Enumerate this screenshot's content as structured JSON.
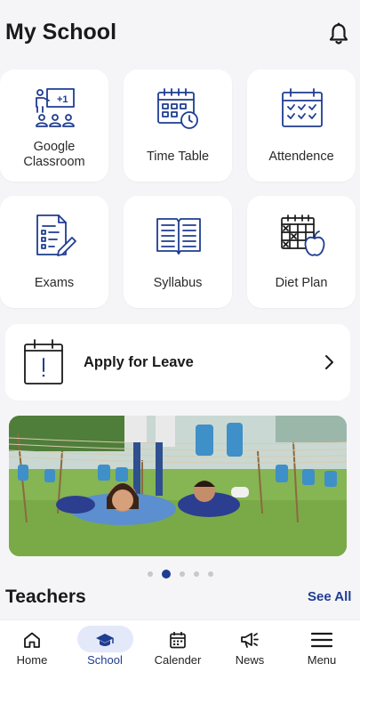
{
  "header": {
    "title": "My School",
    "bell_icon": "bell-icon"
  },
  "grid": [
    {
      "id": "google-classroom",
      "label_line1": "Google",
      "label_line2": "Classroom",
      "icon": "classroom-icon"
    },
    {
      "id": "time-table",
      "label": "Time Table",
      "icon": "calendar-clock-icon"
    },
    {
      "id": "attendance",
      "label": "Attendence",
      "icon": "calendar-check-icon"
    },
    {
      "id": "exams",
      "label": "Exams",
      "icon": "exam-sheet-icon"
    },
    {
      "id": "syllabus",
      "label": "Syllabus",
      "icon": "open-book-icon"
    },
    {
      "id": "diet-plan",
      "label": "Diet Plan",
      "icon": "calendar-apple-icon"
    }
  ],
  "leave": {
    "label": "Apply for Leave",
    "icon": "leave-calendar-icon"
  },
  "banner": {
    "slides": 5,
    "active_slide": 2
  },
  "teachers": {
    "heading": "Teachers",
    "see_all": "See All"
  },
  "nav": {
    "active": "school",
    "items": [
      {
        "id": "home",
        "label": "Home",
        "icon": "home-icon"
      },
      {
        "id": "school",
        "label": "School",
        "icon": "graduation-cap-icon"
      },
      {
        "id": "calender",
        "label": "Calender",
        "icon": "calendar-icon"
      },
      {
        "id": "news",
        "label": "News",
        "icon": "megaphone-icon"
      },
      {
        "id": "menu",
        "label": "Menu",
        "icon": "hamburger-menu-icon"
      }
    ]
  },
  "colors": {
    "accent": "#1f3d91",
    "background": "#f5f5f7",
    "card": "#ffffff",
    "active_pill": "#e4e9fa"
  }
}
